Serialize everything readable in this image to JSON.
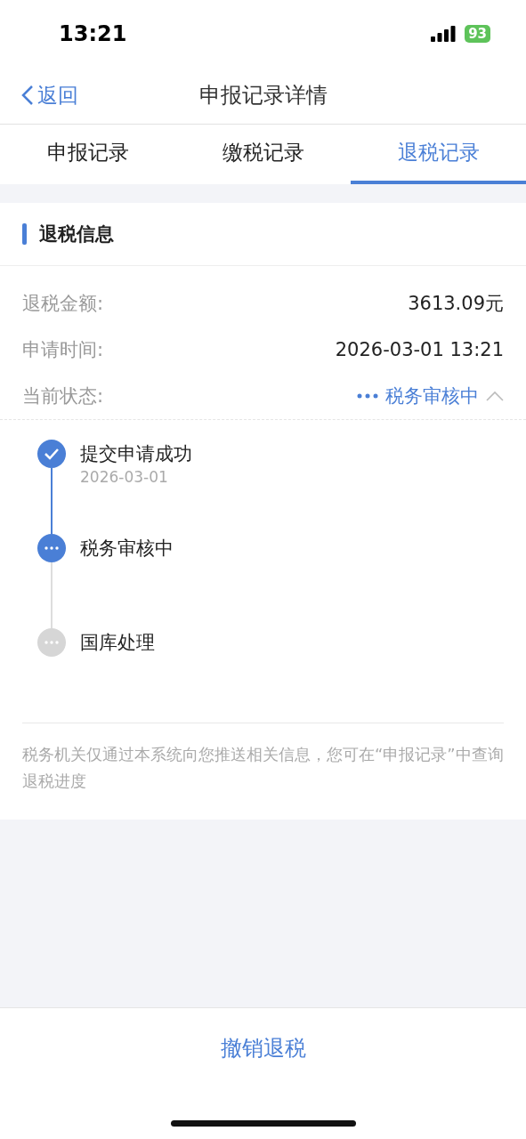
{
  "status_bar": {
    "time": "13:21",
    "battery": "93"
  },
  "nav": {
    "back": "返回",
    "title": "申报记录详情"
  },
  "tabs": [
    {
      "label": "申报记录",
      "selected": false
    },
    {
      "label": "缴税记录",
      "selected": false
    },
    {
      "label": "退税记录",
      "selected": true
    }
  ],
  "section": {
    "title": "退税信息"
  },
  "fields": [
    {
      "label": "退税金额:",
      "value": "3613.09元"
    },
    {
      "label": "申请时间:",
      "value": "2026-03-01 13:21"
    }
  ],
  "status": {
    "label": "当前状态:",
    "value": "税务审核中",
    "expanded": true
  },
  "steps": [
    {
      "title": "提交申请成功",
      "date": "2026-03-01",
      "kind": "done"
    },
    {
      "title": "税务审核中",
      "kind": "current"
    },
    {
      "title": "国库处理",
      "kind": "pending"
    }
  ],
  "note": "税务机关仅通过本系统向您推送相关信息，您可在“申报记录”中查询退税进度",
  "bottom_button": "撤销退税"
}
